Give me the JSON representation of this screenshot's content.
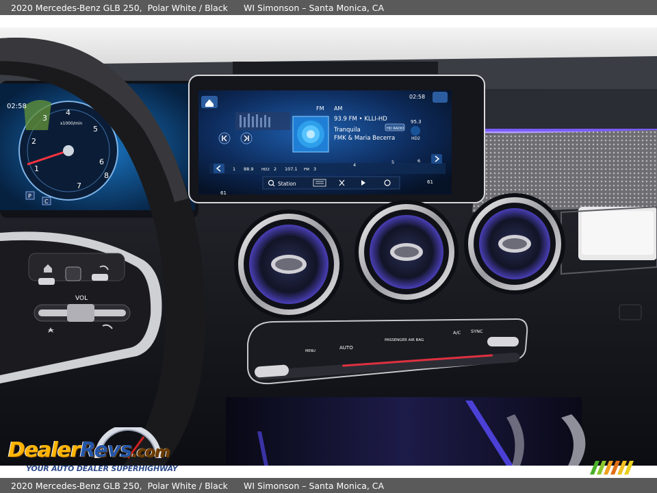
{
  "caption": {
    "vehicle": "2020 Mercedes-Benz GLB 250,",
    "colors": "Polar White / Black",
    "dealer": "WI Simonson – Santa Monica, CA"
  },
  "cluster": {
    "time": "02:58",
    "rpm_label": "x1000/min",
    "gauge_ticks": [
      "1",
      "2",
      "3",
      "4",
      "5",
      "6",
      "7",
      "8"
    ],
    "gears": [
      "P",
      "C"
    ]
  },
  "infotainment": {
    "band_fm": "FM",
    "band_am": "AM",
    "time": "02:58",
    "station": "93.9 FM • KLLI-HD",
    "song": "Tranquila",
    "artist": "FMK & Maria Becerra",
    "hd_badge": "HD RADIO",
    "presets": [
      "1",
      "88.9",
      "HD2",
      "2",
      "107.1",
      "FM",
      "3",
      "4",
      "5",
      "6"
    ],
    "station_button": "Station",
    "temp_left": "61",
    "temp_right": "61",
    "side_freq": "95.3",
    "side_badge": "HD2"
  },
  "climate": {
    "labels": [
      "AUTO",
      "PASSENGER AIR BAG",
      "A/C",
      "SYNC",
      "MENU"
    ]
  },
  "steering": {
    "vol": "VOL"
  },
  "watermark": {
    "word_part1": "Dealer",
    "word_part2": "Revs",
    "word_part3": ".com",
    "tagline": "YOUR AUTO DEALER SUPERHIGHWAY",
    "colors": [
      "#ffb400",
      "#2456a8",
      "#6a3b00"
    ]
  }
}
